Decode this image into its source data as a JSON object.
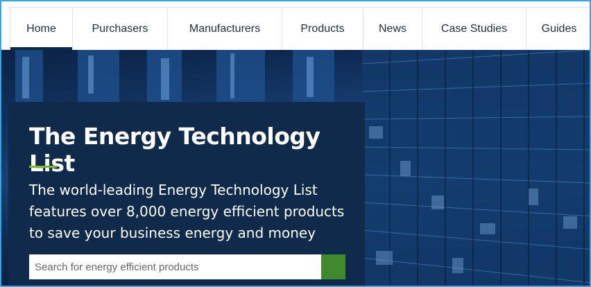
{
  "nav": {
    "items": [
      {
        "label": "Home",
        "active": true
      },
      {
        "label": "Purchasers"
      },
      {
        "label": "Manufacturers"
      },
      {
        "label": "Products"
      },
      {
        "label": "News"
      },
      {
        "label": "Case Studies"
      },
      {
        "label": "Guides"
      }
    ]
  },
  "hero": {
    "title": "The Energy Technology List",
    "description": "The world-leading Energy Technology List features over 8,000 energy efficient products to save your business energy and money",
    "search": {
      "placeholder": "Search for energy efficient products",
      "value": "",
      "button_icon": "search-icon"
    }
  },
  "colors": {
    "panel": "#0f2a4a",
    "accent": "#7ab828",
    "search_button": "#3f8a2c",
    "active_tab_underline": "#0b2a4a"
  }
}
